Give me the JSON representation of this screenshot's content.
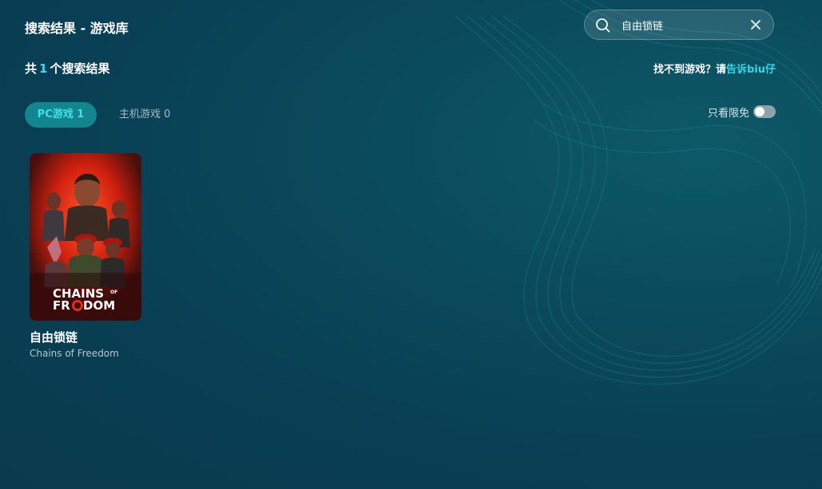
{
  "header": {
    "title": "搜索结果 - 游戏库"
  },
  "search": {
    "value": "自由锁链",
    "icon": "search-icon",
    "clear_icon": "close-icon"
  },
  "results": {
    "prefix": "共",
    "count": "1",
    "suffix": "个搜索结果"
  },
  "feedback": {
    "text": "找不到游戏？请",
    "link": "告诉biu仔"
  },
  "tabs": [
    {
      "label": "PC游戏 1",
      "active": true
    },
    {
      "label": "主机游戏 0",
      "active": false
    }
  ],
  "filter": {
    "label": "只看限免",
    "enabled": false
  },
  "games": [
    {
      "title": "自由锁链",
      "subtitle": "Chains of Freedom",
      "cover_logo_line1": "CHAINS",
      "cover_logo_of": "OF",
      "cover_logo_line2": "FR",
      "cover_logo_line2b": "DOM"
    }
  ],
  "colors": {
    "accent": "#33d6e6",
    "tab_active_bg": "#12858f",
    "cover_red": "#e0301a"
  }
}
